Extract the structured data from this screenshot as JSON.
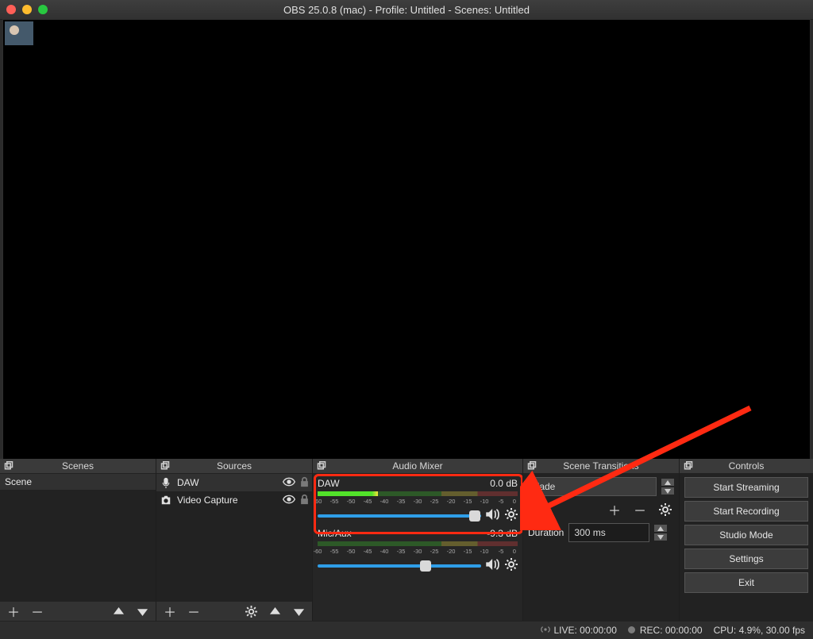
{
  "title": "OBS 25.0.8 (mac) - Profile: Untitled - Scenes: Untitled",
  "panels": {
    "scenes": {
      "title": "Scenes",
      "items": [
        "Scene"
      ]
    },
    "sources": {
      "title": "Sources",
      "items": [
        {
          "name": "DAW",
          "icon": "mic"
        },
        {
          "name": "Video Capture",
          "icon": "camera"
        }
      ]
    },
    "mixer": {
      "title": "Audio Mixer",
      "ticks": [
        "-60",
        "-55",
        "-50",
        "-45",
        "-40",
        "-35",
        "-30",
        "-25",
        "-20",
        "-15",
        "-10",
        "-5",
        "0"
      ],
      "tracks": [
        {
          "name": "DAW",
          "db": "0.0 dB",
          "fill_pct": 30,
          "thumb_pct": 96
        },
        {
          "name": "Mic/Aux",
          "db": "-9.3 dB",
          "fill_pct": 0,
          "thumb_pct": 66
        }
      ]
    },
    "transitions": {
      "title": "Scene Transitions",
      "current": "Fade",
      "duration_label": "Duration",
      "duration_value": "300 ms"
    },
    "controls": {
      "title": "Controls",
      "buttons": [
        "Start Streaming",
        "Start Recording",
        "Studio Mode",
        "Settings",
        "Exit"
      ]
    }
  },
  "status": {
    "live": "LIVE: 00:00:00",
    "rec": "REC: 00:00:00",
    "cpu": "CPU: 4.9%, 30.00 fps"
  }
}
